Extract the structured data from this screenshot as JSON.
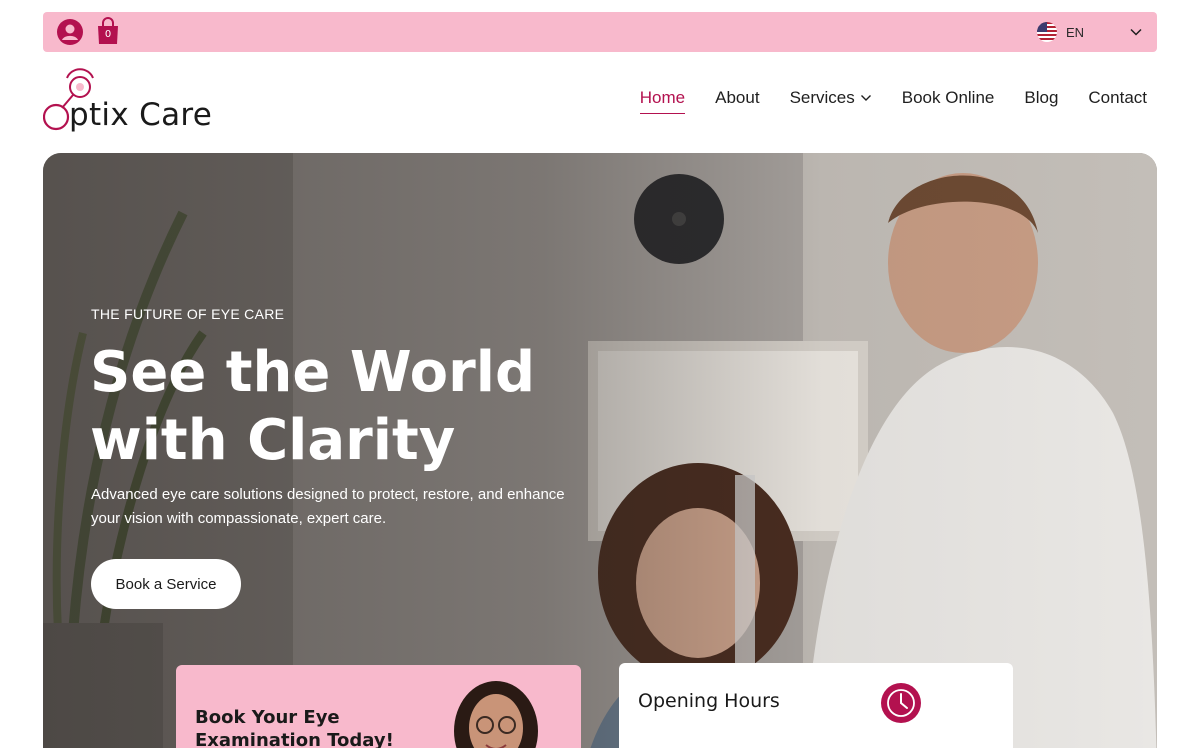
{
  "topbar": {
    "cart_count": "0",
    "language": "EN",
    "icons": {
      "user": "user-icon",
      "cart": "shopping-bag-icon",
      "flag": "us-flag-icon",
      "dropdown": "chevron-down-icon"
    }
  },
  "brand": {
    "name": "Optix Care",
    "name_suffix": "ptix Care",
    "accent_color": "#b3114f",
    "pink_color": "#f8b9cc"
  },
  "nav": {
    "items": [
      {
        "label": "Home",
        "active": true
      },
      {
        "label": "About",
        "active": false
      },
      {
        "label": "Services",
        "active": false,
        "has_dropdown": true
      },
      {
        "label": "Book Online",
        "active": false
      },
      {
        "label": "Blog",
        "active": false
      },
      {
        "label": "Contact",
        "active": false
      }
    ]
  },
  "hero": {
    "eyebrow": "THE FUTURE OF EYE CARE",
    "title_line1": "See the World",
    "title_line2": "with Clarity",
    "subtitle": "Advanced eye care solutions designed to protect, restore, and enhance your vision with compassionate, expert care.",
    "cta_label": "Book a Service"
  },
  "cards": {
    "book": {
      "title": "Book Your Eye Examination Today!"
    },
    "hours": {
      "title": "Opening Hours",
      "icon": "clock-icon"
    }
  }
}
